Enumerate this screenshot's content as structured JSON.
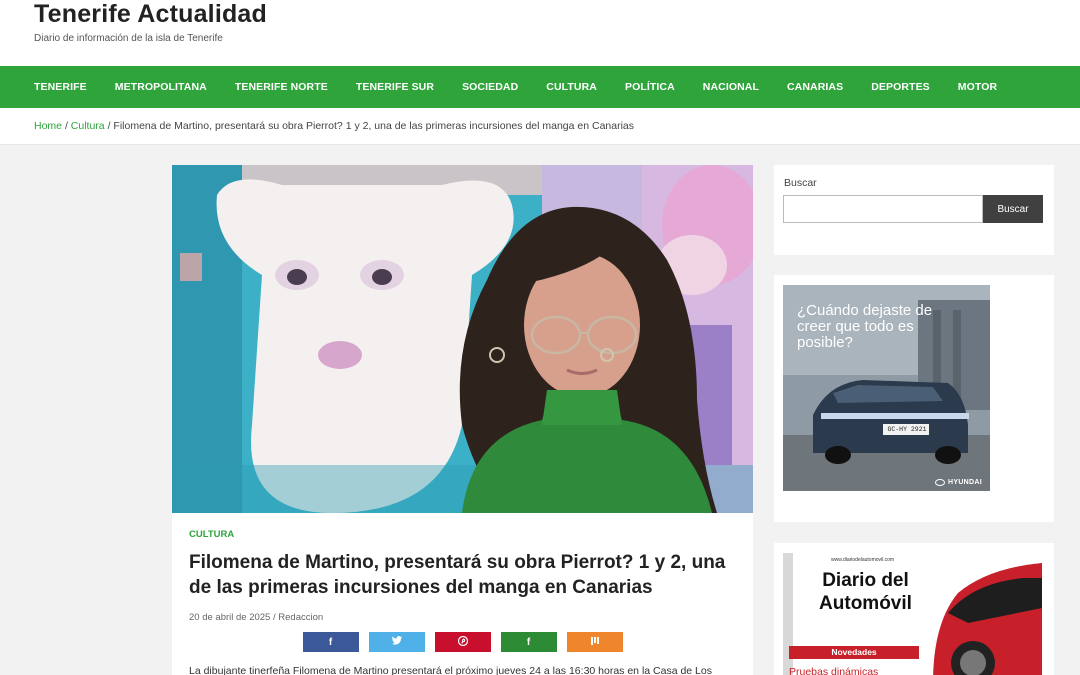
{
  "site": {
    "title": "Tenerife Actualidad",
    "tagline": "Diario de información de la isla de Tenerife"
  },
  "nav": {
    "items": [
      "TENERIFE",
      "METROPOLITANA",
      "TENERIFE NORTE",
      "TENERIFE SUR",
      "SOCIEDAD",
      "CULTURA",
      "POLÍTICA",
      "NACIONAL",
      "CANARIAS",
      "DEPORTES",
      "MOTOR"
    ]
  },
  "breadcrumb": {
    "home": "Home",
    "section": "Cultura",
    "current": "Filomena de Martino, presentará su obra Pierrot? 1 y 2, una de las primeras incursiones del manga en Canarias"
  },
  "article": {
    "category": "CULTURA",
    "headline": "Filomena de Martino, presentará su obra Pierrot? 1 y 2, una de las primeras incursiones del manga en Canarias",
    "date": "20 de abril de 2025",
    "author": "Redaccion",
    "excerpt": "La dibujante tinerfeña Filomena de Martino presentará el próximo jueves 24 a las 16:30 horas en la Casa de Los"
  },
  "share": [
    {
      "name": "facebook",
      "glyph": "f",
      "color": "#3b5998"
    },
    {
      "name": "twitter",
      "glyph": "🐦",
      "color": "#4fb1e8"
    },
    {
      "name": "pinterest",
      "glyph": "℗",
      "color": "#c8102e"
    },
    {
      "name": "flipboard-green",
      "glyph": "f",
      "color": "#2e8b35"
    },
    {
      "name": "mix",
      "glyph": "m",
      "color": "#f0862c"
    }
  ],
  "sidebar": {
    "search_label": "Buscar",
    "search_button": "Buscar",
    "search_placeholder": "",
    "ad1_text": "¿Cuándo dejaste de creer que todo es posible?",
    "ad1_brand": "HYUNDAI",
    "ad1_plate": "GC-HY 2921",
    "ad2_url": "www.diariodelautomovil.com",
    "ad2_title": "Diario del Automóvil",
    "ad2_tag": "Novedades",
    "ad2_link": "Pruebas dinámicas"
  }
}
